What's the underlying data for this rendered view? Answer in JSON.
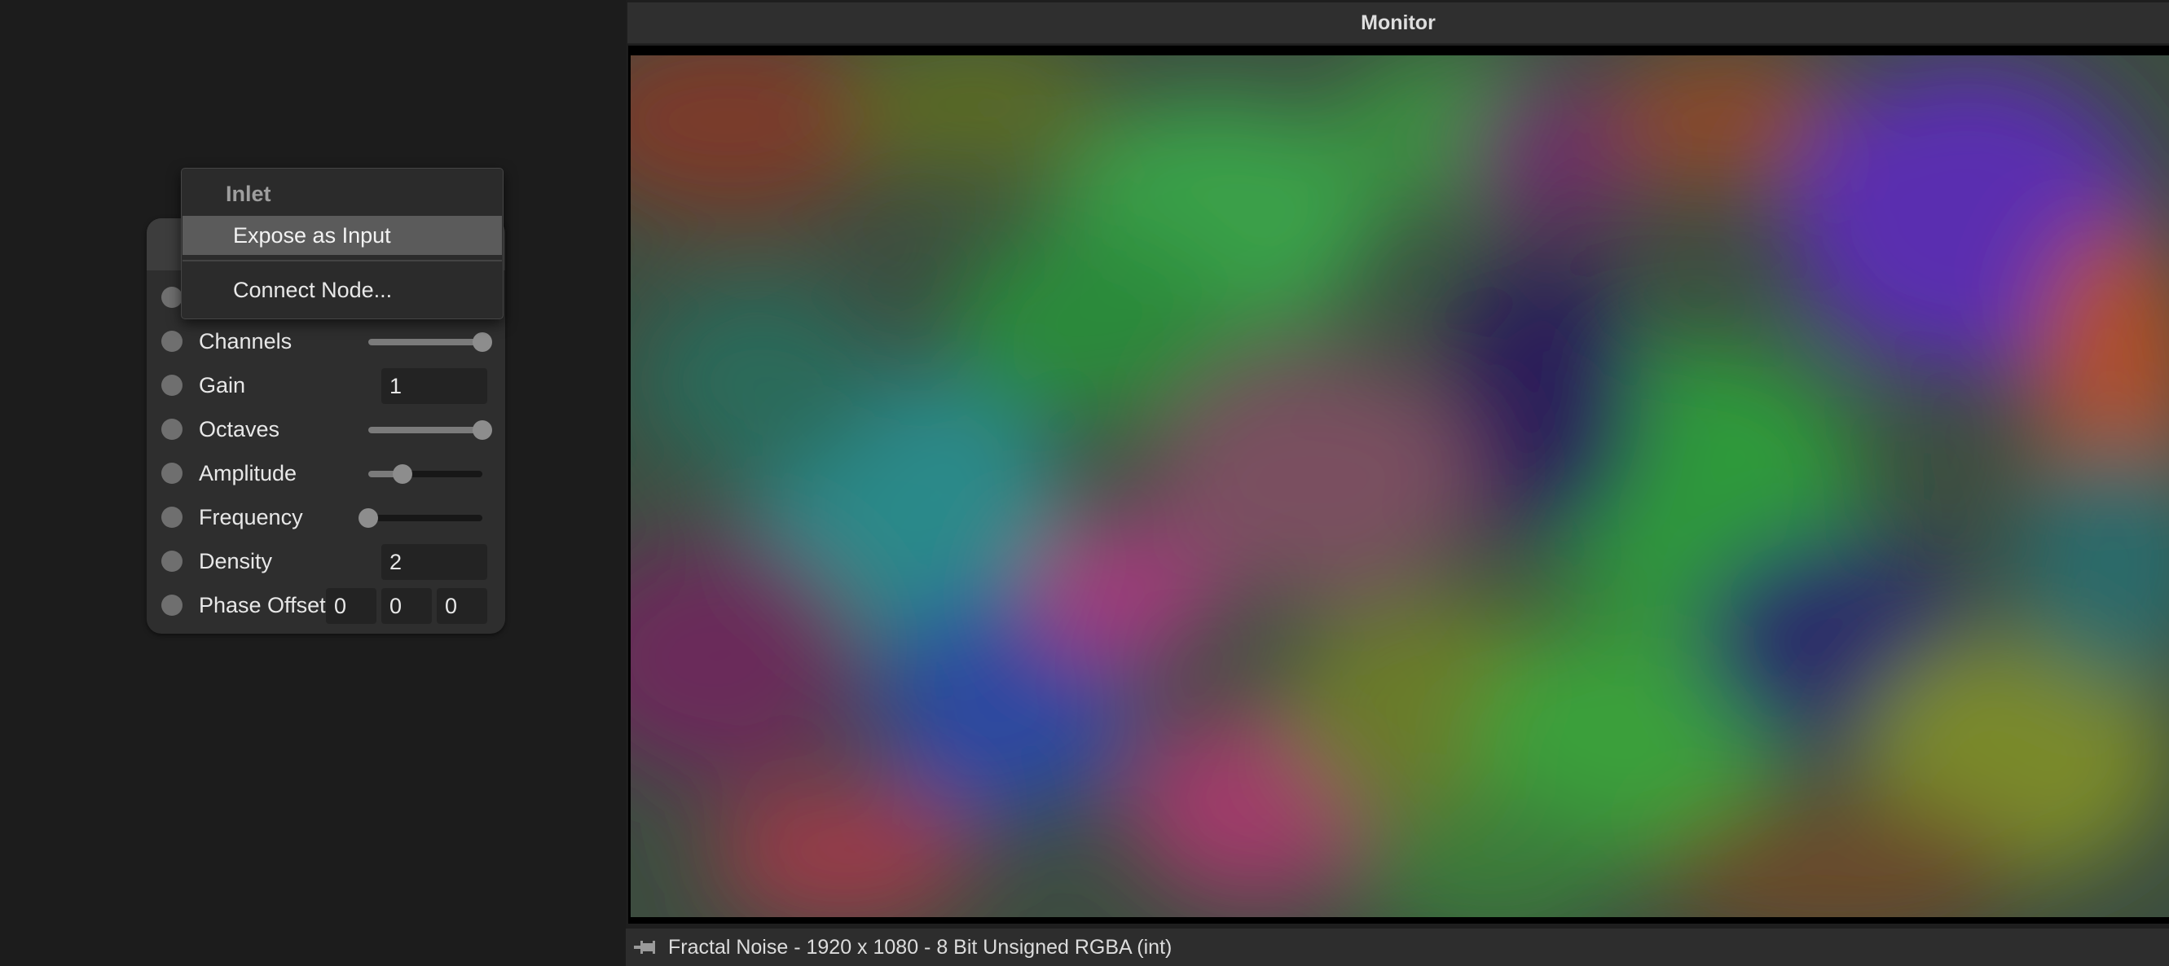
{
  "context_menu": {
    "header": "Inlet",
    "items": [
      {
        "label": "Expose as Input",
        "highlighted": true
      },
      {
        "label": "Connect Node..."
      }
    ]
  },
  "node": {
    "parameters": [
      {
        "label": "Channels",
        "control": "slider",
        "level": 1.0
      },
      {
        "label": "Gain",
        "control": "number",
        "value": "1"
      },
      {
        "label": "Octaves",
        "control": "slider",
        "level": 1.0
      },
      {
        "label": "Amplitude",
        "control": "slider",
        "level": 0.3
      },
      {
        "label": "Frequency",
        "control": "slider",
        "level": 0.0
      },
      {
        "label": "Density",
        "control": "number",
        "value": "2"
      },
      {
        "label": "Phase Offset",
        "control": "vector3",
        "values": [
          "0",
          "0",
          "0"
        ]
      }
    ]
  },
  "monitor": {
    "title": "Monitor",
    "status_icon": "pin-icon",
    "status_text": "Fractal Noise - 1920 x 1080 - 8 Bit Unsigned RGBA (int)"
  },
  "colors": {
    "background": "#1c1c1c",
    "node_body": "#2e2e2e",
    "menu_highlight": "#5b5b5b",
    "panel_header": "#2f2f2f"
  }
}
